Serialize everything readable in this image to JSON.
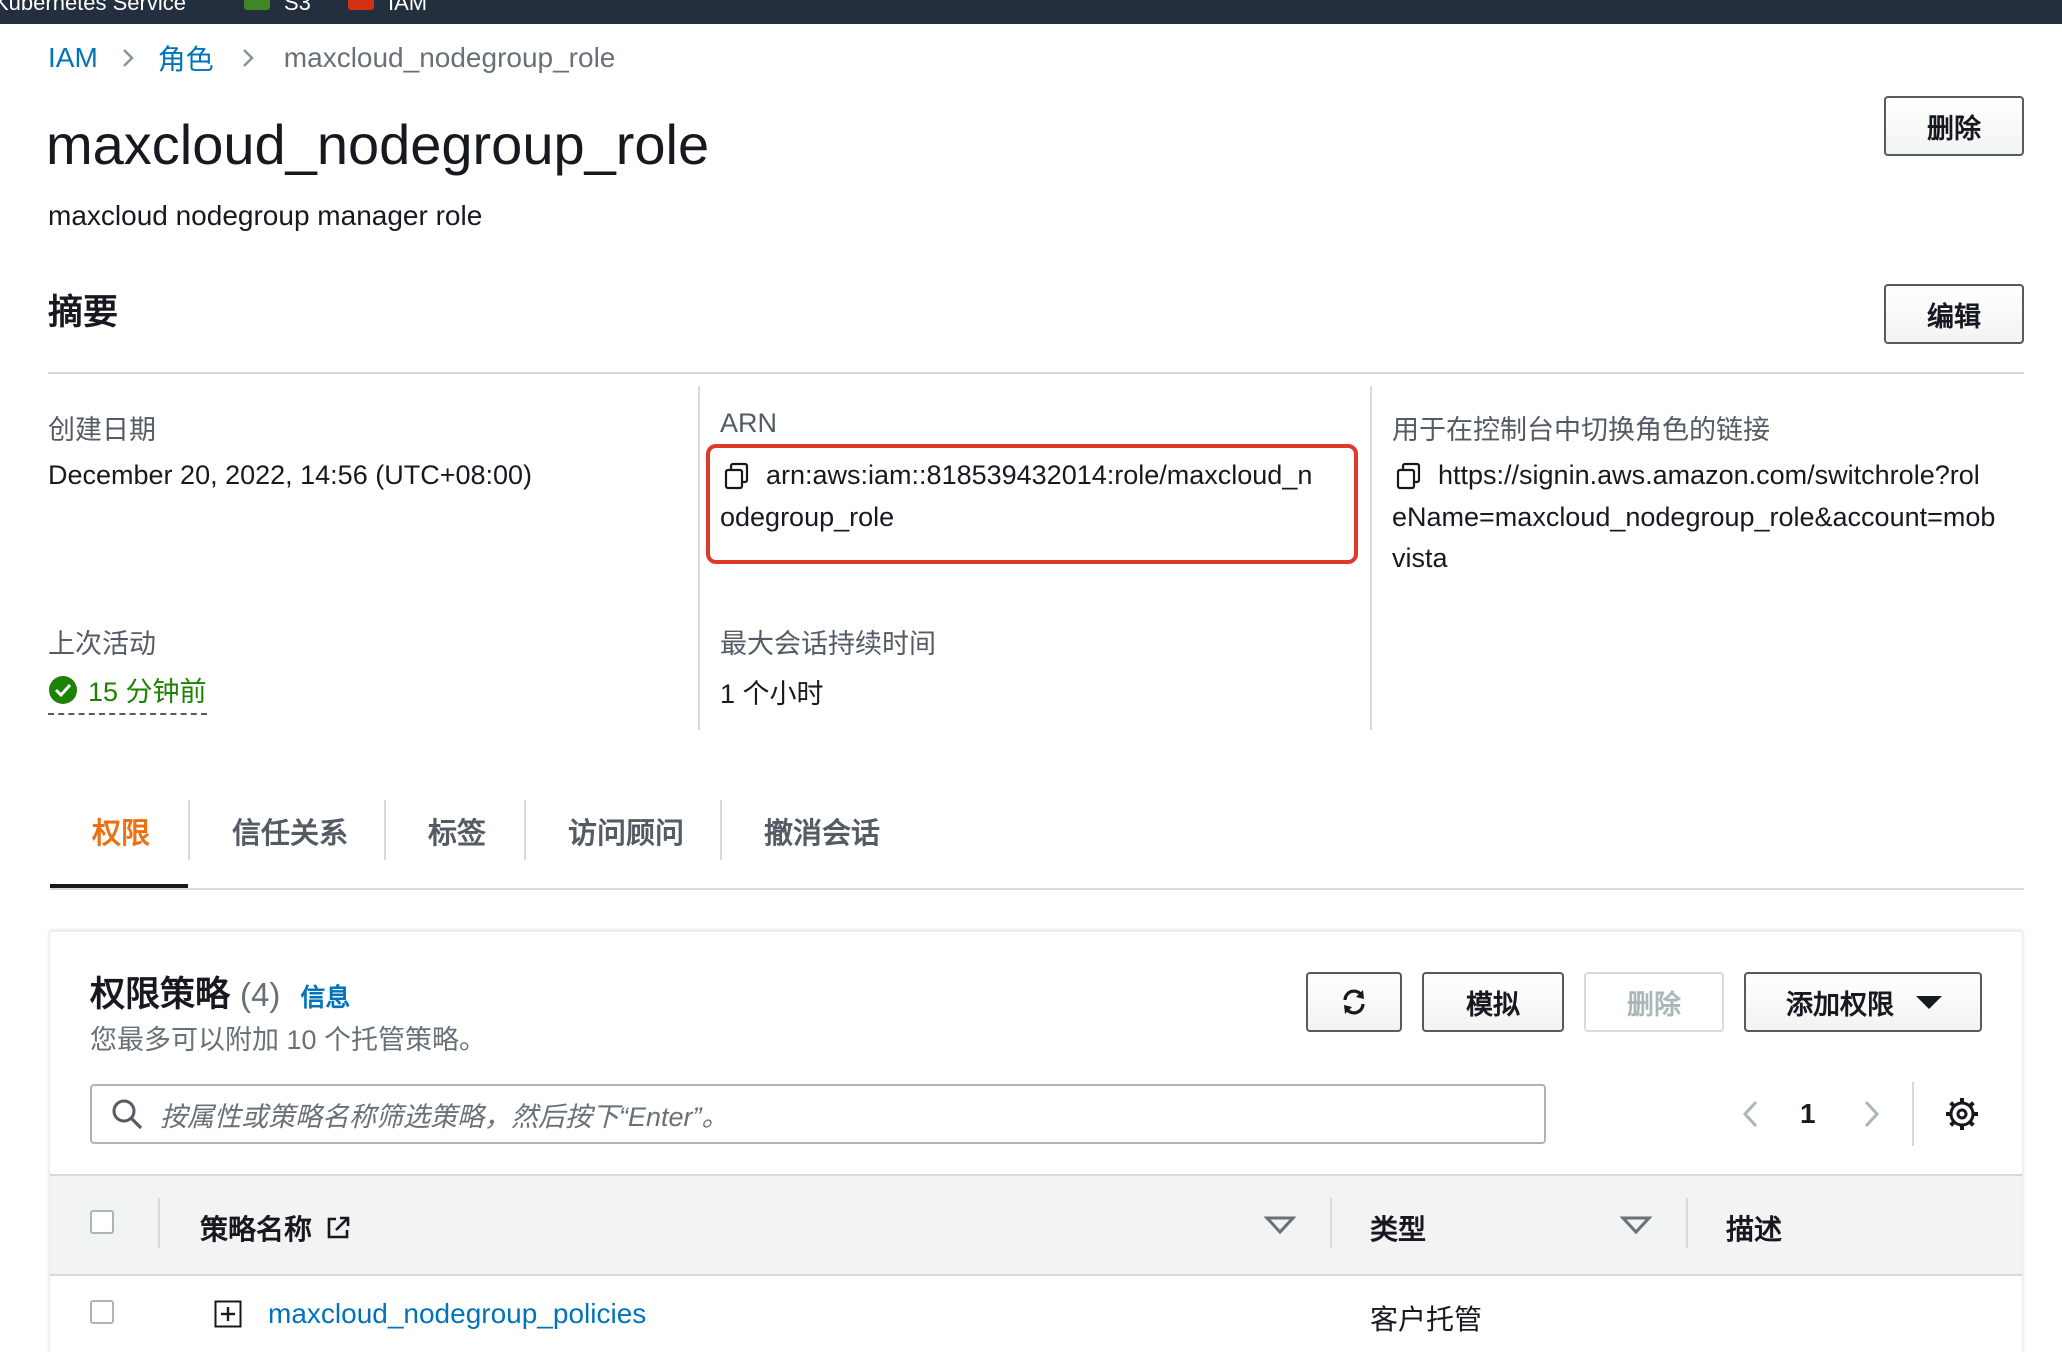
{
  "topbar": {
    "items": [
      {
        "label": "Kubernetes Service",
        "color": ""
      },
      {
        "label": "S3",
        "color": "#3f8624"
      },
      {
        "label": "IAM",
        "color": "#d13212"
      }
    ]
  },
  "breadcrumb": {
    "items": [
      "IAM",
      "角色",
      "maxcloud_nodegroup_role"
    ]
  },
  "header": {
    "title": "maxcloud_nodegroup_role",
    "description": "maxcloud nodegroup manager role",
    "delete_label": "删除"
  },
  "summary": {
    "heading": "摘要",
    "edit_label": "编辑",
    "created_label": "创建日期",
    "created_value": "December 20, 2022, 14:56 (UTC+08:00)",
    "arn_label": "ARN",
    "arn_line1": "arn:aws:iam::818539432014:role/maxcloud_n",
    "arn_line2": "odegroup_role",
    "switch_label": "用于在控制台中切换角色的链接",
    "switch_line1": "https://signin.aws.amazon.com/switchrole?rol",
    "switch_line2": "eName=maxcloud_nodegroup_role&account=mob",
    "switch_line3": "vista",
    "last_activity_label": "上次活动",
    "last_activity_value": "15 分钟前",
    "max_session_label": "最大会话持续时间",
    "max_session_value": "1 个小时"
  },
  "tabs": [
    "权限",
    "信任关系",
    "标签",
    "访问顾问",
    "撤消会话"
  ],
  "permissions": {
    "title": "权限策略",
    "count": "(4)",
    "info": "信息",
    "subtitle": "您最多可以附加 10 个托管策略。",
    "simulate_label": "模拟",
    "delete_label": "删除",
    "add_label": "添加权限",
    "search_placeholder": "按属性或策略名称筛选策略，然后按下“Enter”。",
    "page_number": "1",
    "columns": [
      "策略名称",
      "类型",
      "描述"
    ],
    "rows": [
      {
        "name": "maxcloud_nodegroup_policies",
        "type": "客户托管"
      }
    ]
  },
  "colors": {
    "accent_tab": "#ec7211",
    "link": "#0073bb",
    "success": "#1d8102",
    "highlight_box": "#e0392b"
  }
}
